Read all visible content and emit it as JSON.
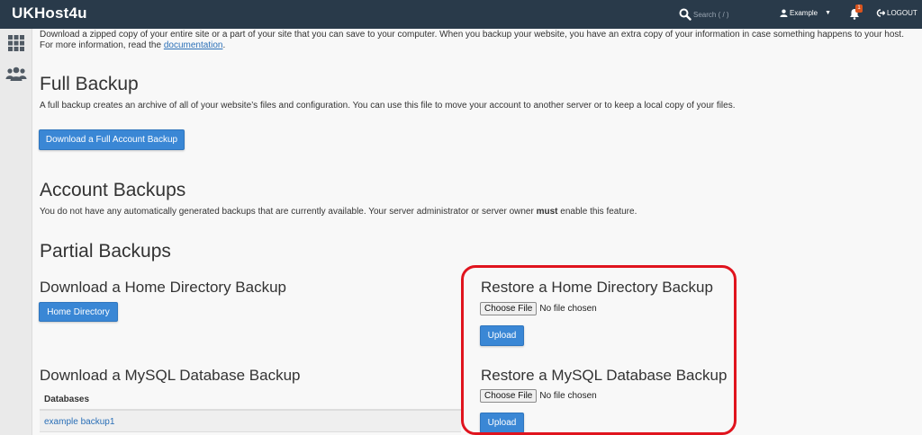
{
  "header": {
    "brand": "UKHost4u",
    "search_placeholder": "Search ( / )",
    "user_label": "Example",
    "notification_count": "1",
    "logout_label": "LOGOUT"
  },
  "colors": {
    "topbar": "#293a4a",
    "primary_button": "#3a87d5",
    "link": "#2a6fb7",
    "highlight": "#e0141e"
  },
  "sidebar": {
    "items": [
      {
        "icon": "grid-icon"
      },
      {
        "icon": "users-icon"
      }
    ]
  },
  "intro": {
    "text": "Download a zipped copy of your entire site or a part of your site that you can save to your computer. When you backup your website, you have an extra copy of your information in case something happens to your host. For more information, read the ",
    "link_text": "documentation",
    "suffix": "."
  },
  "full_backup": {
    "title": "Full Backup",
    "description": "A full backup creates an archive of all of your website’s files and configuration. You can use this file to move your account to another server or to keep a local copy of your files.",
    "button": "Download a Full Account Backup"
  },
  "account_backups": {
    "title": "Account Backups",
    "description_before": "You do not have any automatically generated backups that are currently available. Your server administrator or server owner ",
    "description_bold": "must",
    "description_after": " enable this feature."
  },
  "partial_backups": {
    "title": "Partial Backups",
    "home_dir": {
      "title": "Download a Home Directory Backup",
      "button": "Home Directory"
    },
    "mysql": {
      "title": "Download a MySQL Database Backup",
      "table_header": "Databases",
      "rows": [
        "example backup1"
      ]
    },
    "restore_home": {
      "title": "Restore a Home Directory Backup",
      "choose_label": "Choose File",
      "no_file": "No file chosen",
      "upload": "Upload"
    },
    "restore_mysql": {
      "title": "Restore a MySQL Database Backup",
      "choose_label": "Choose File",
      "no_file": "No file chosen",
      "upload": "Upload"
    }
  }
}
